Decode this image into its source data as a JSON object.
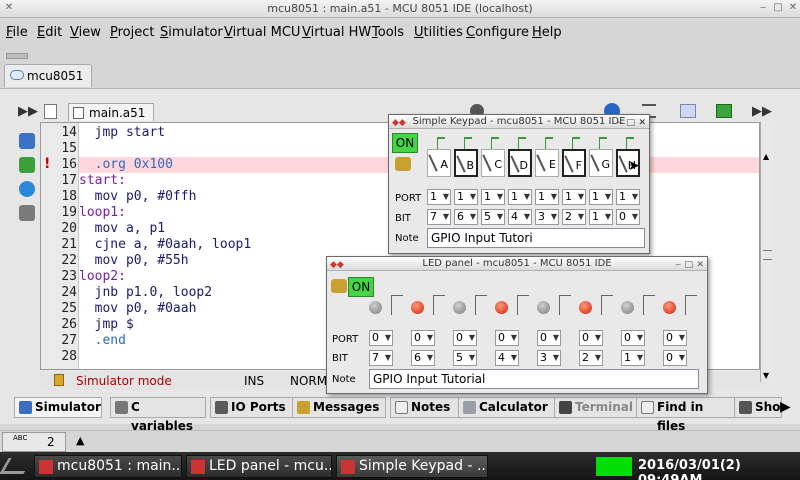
{
  "window": {
    "title": "mcu8051 : main.a51 - MCU 8051 IDE (localhost)"
  },
  "menubar": [
    {
      "label": "File",
      "u": "F",
      "rest": "ile"
    },
    {
      "label": "Edit",
      "u": "E",
      "rest": "dit"
    },
    {
      "label": "View",
      "u": "V",
      "rest": "iew"
    },
    {
      "label": "Project",
      "u": "P",
      "rest": "roject"
    },
    {
      "label": "Simulator",
      "u": "S",
      "rest": "imulator"
    },
    {
      "label": "Virtual MCU",
      "u": "V",
      "rest": "irtual MCU"
    },
    {
      "label": "Virtual HW",
      "u": "V",
      "rest": "irtual HW"
    },
    {
      "label": "Tools",
      "u": "T",
      "rest": "ools"
    },
    {
      "label": "Utilities",
      "u": "U",
      "rest": "tilities"
    },
    {
      "label": "Configure",
      "u": "C",
      "rest": "onfigure"
    },
    {
      "label": "Help",
      "u": "H",
      "rest": "elp"
    }
  ],
  "project_tab": {
    "label": "mcu8051"
  },
  "file_tab": {
    "label": "main.a51"
  },
  "editor": {
    "lines": [
      {
        "n": "14",
        "code": "  jmp start"
      },
      {
        "n": "15",
        "code": ""
      },
      {
        "n": "16",
        "code": "  .org 0x100"
      },
      {
        "n": "17",
        "code": "start:"
      },
      {
        "n": "18",
        "code": "  mov p0, #0ffh"
      },
      {
        "n": "19",
        "code": "loop1:"
      },
      {
        "n": "20",
        "code": "  mov a, p1"
      },
      {
        "n": "21",
        "code": "  cjne a, #0aah, loop1"
      },
      {
        "n": "22",
        "code": "  mov p0, #55h"
      },
      {
        "n": "23",
        "code": "loop2:"
      },
      {
        "n": "24",
        "code": "  jnb p1.0, loop2"
      },
      {
        "n": "25",
        "code": "  mov p0, #0aah"
      },
      {
        "n": "26",
        "code": "  jmp $"
      },
      {
        "n": "27",
        "code": "  .end"
      },
      {
        "n": "28",
        "code": ""
      }
    ],
    "error_marker": "!"
  },
  "editor_status": {
    "mode": "Simulator mode",
    "ins": "INS",
    "norm": "NORM"
  },
  "bottom_tabs": [
    {
      "label": "Simulator",
      "selected": true
    },
    {
      "label": "C variables"
    },
    {
      "label": "IO Ports"
    },
    {
      "label": "Messages"
    },
    {
      "label": "Notes"
    },
    {
      "label": "Calculator"
    },
    {
      "label": "Terminal",
      "disabled": true
    },
    {
      "label": "Find in files"
    },
    {
      "label": "Sho"
    }
  ],
  "spell": {
    "icon_text": "ABC",
    "count": "2"
  },
  "taskbar": {
    "tasks": [
      {
        "label": "mcu8051 : main...."
      },
      {
        "label": "LED panel - mcu..."
      },
      {
        "label": "Simple Keypad - ..."
      }
    ],
    "clock": "2016/03/01(2) 09:49AM",
    "indicator_color": "#00dd00"
  },
  "keypad": {
    "title": "Simple Keypad - mcu8051 - MCU 8051 IDE",
    "on_label": "ON",
    "keys": [
      "A",
      "B",
      "C",
      "D",
      "E",
      "F",
      "G",
      "H"
    ],
    "boxed": [
      false,
      true,
      false,
      true,
      false,
      true,
      false,
      true
    ],
    "port_label": "PORT",
    "bit_label": "BIT",
    "ports": [
      "1",
      "1",
      "1",
      "1",
      "1",
      "1",
      "1",
      "1"
    ],
    "bits": [
      "7",
      "6",
      "5",
      "4",
      "3",
      "2",
      "1",
      "0"
    ],
    "note_label": "Note",
    "note_value": "GPIO Input Tutori"
  },
  "led_panel": {
    "title": "LED panel - mcu8051 - MCU 8051 IDE",
    "on_label": "ON",
    "leds": [
      "off",
      "on",
      "off",
      "on",
      "off",
      "on",
      "off",
      "on"
    ],
    "port_label": "PORT",
    "bit_label": "BIT",
    "ports": [
      "0",
      "0",
      "0",
      "0",
      "0",
      "0",
      "0",
      "0"
    ],
    "bits": [
      "7",
      "6",
      "5",
      "4",
      "3",
      "2",
      "1",
      "0"
    ],
    "note_label": "Note",
    "note_value": "GPIO Input Tutorial"
  },
  "colors": {
    "highlight_line": "#ffd6dc",
    "selection_band": "#c8c8f0",
    "led_on": "#d0200a",
    "on_button": "#44d444"
  }
}
